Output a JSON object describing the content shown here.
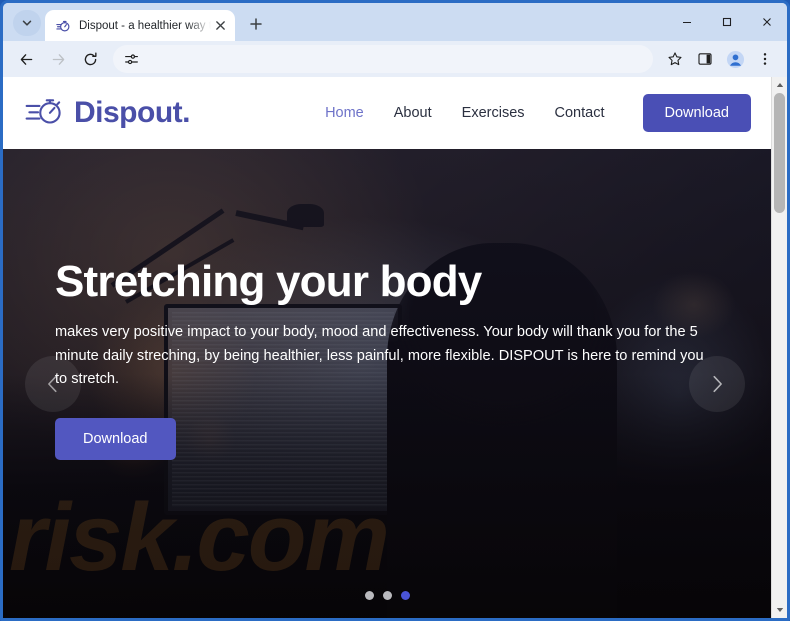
{
  "browser": {
    "tab": {
      "title": "Dispout - a healthier way to wo",
      "favicon_icon": "stopwatch-icon",
      "close_icon": "close-icon"
    },
    "tab_list_icon": "chevron-down-icon",
    "new_tab_icon": "plus-icon",
    "window_controls": {
      "minimize_icon": "minimize-icon",
      "maximize_icon": "maximize-icon",
      "close_icon": "close-icon"
    },
    "toolbar": {
      "back_icon": "back-arrow-icon",
      "forward_icon": "forward-arrow-icon",
      "reload_icon": "reload-icon",
      "omnibox_value": "",
      "omnibox_placeholder": "",
      "tune_icon": "tune-icon",
      "bookmark_icon": "star-icon",
      "side_panel_icon": "side-panel-icon",
      "profile_icon": "profile-avatar-icon",
      "menu_icon": "three-dot-menu-icon"
    },
    "scrollbar": {
      "up_icon": "scroll-up-arrow-icon",
      "down_icon": "scroll-down-arrow-icon"
    }
  },
  "site": {
    "logo": {
      "icon": "stopwatch-icon",
      "wordmark": "Dispout."
    },
    "nav": [
      {
        "label": "Home",
        "active": true
      },
      {
        "label": "About",
        "active": false
      },
      {
        "label": "Exercises",
        "active": false
      },
      {
        "label": "Contact",
        "active": false
      }
    ],
    "header_cta_label": "Download",
    "hero": {
      "title": "Stretching your body",
      "paragraph": "makes very positive impact to your body, mood and effectiveness. Your body will thank you for the 5 minute daily streching, by being healthier, less painful, more flexible. DISPOUT is here to remind you to stretch.",
      "cta_label": "Download",
      "watermark": "risk.com",
      "prev_icon": "chevron-left-icon",
      "next_icon": "chevron-right-icon",
      "slides": [
        {
          "active": false
        },
        {
          "active": false
        },
        {
          "active": true
        }
      ]
    }
  },
  "colors": {
    "brand_purple": "#4a4fa8",
    "button_purple": "#4a4fb5",
    "hero_button_purple": "#5257c0",
    "nav_active": "#6e73c9",
    "dot_active": "#4a54d6",
    "dot_inactive": "#b9b9bd",
    "watermark_amber": "#c67a28",
    "chrome_tabstrip": "#ccdcf2",
    "chrome_toolbar": "#e8eef8",
    "window_border": "#2b6cc4"
  }
}
